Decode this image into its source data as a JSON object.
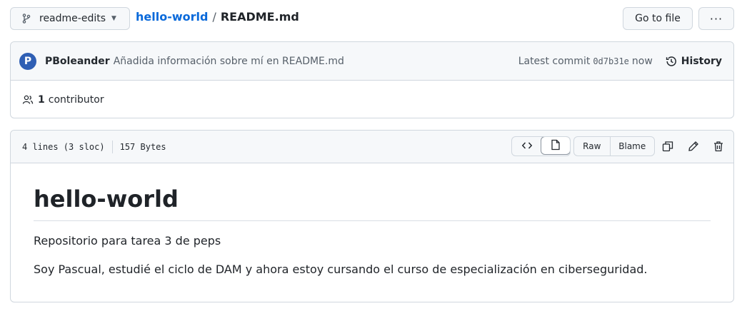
{
  "branch": {
    "name": "readme-edits",
    "icon": "git-branch-icon"
  },
  "breadcrumb": {
    "repo": "hello-world",
    "separator": "/",
    "file": "README.md"
  },
  "toolbar": {
    "go_to_file": "Go to file",
    "more": "···"
  },
  "commit": {
    "avatar_letter": "P",
    "author": "PBoleander",
    "message": "Añadida información sobre mí en README.md",
    "latest_label": "Latest commit",
    "sha": "0d7b31e",
    "time": "now",
    "history_label": "History"
  },
  "contributors": {
    "count": "1",
    "label": "contributor"
  },
  "file_info": {
    "lines": "4 lines (3 sloc)",
    "size": "157 Bytes"
  },
  "file_actions": {
    "raw": "Raw",
    "blame": "Blame"
  },
  "readme": {
    "heading": "hello-world",
    "paragraphs": [
      "Repositorio para tarea 3 de peps",
      "Soy Pascual, estudié el ciclo de DAM y ahora estoy cursando el curso de especialización en ciberseguridad."
    ]
  },
  "colors": {
    "link": "#0969da",
    "border": "#d0d7de",
    "header_bg": "#f6f8fa",
    "avatar": "#2f5fb4"
  }
}
